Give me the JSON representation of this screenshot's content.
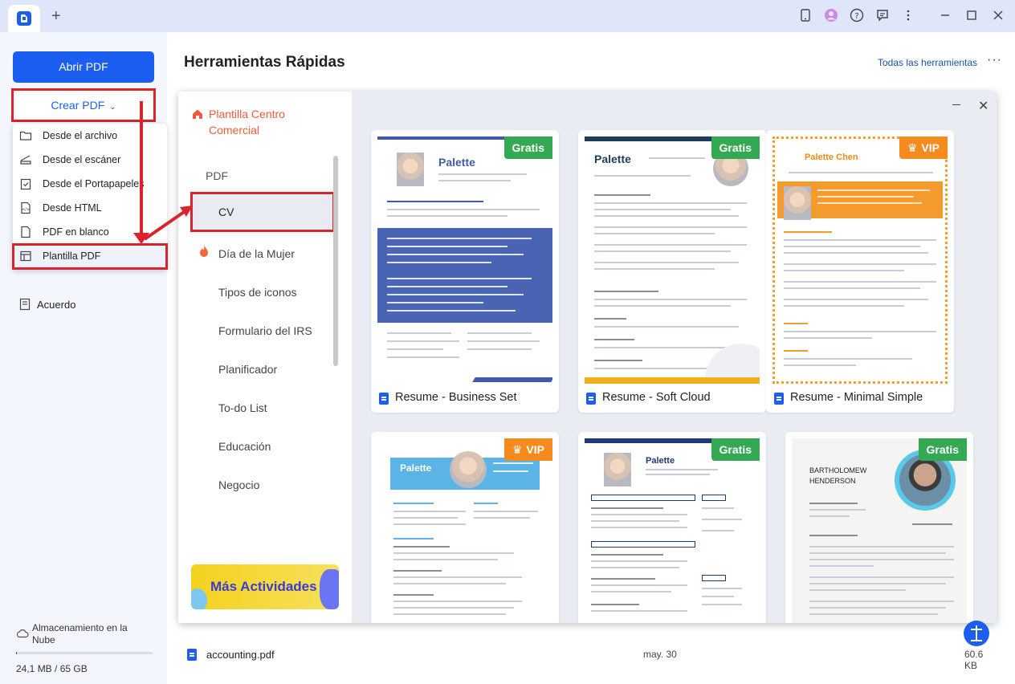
{
  "titlebar": {
    "new_tab_symbol": "+",
    "icons": [
      "tablet-icon",
      "avatar-icon",
      "help-icon",
      "feedback-icon",
      "more-vertical-icon",
      "minimize-icon",
      "maximize-icon",
      "close-icon"
    ]
  },
  "sidebar": {
    "open_button": "Abrir PDF",
    "create_button": "Crear PDF",
    "create_menu": [
      {
        "label": "Desde el archivo",
        "icon": "folder-icon"
      },
      {
        "label": "Desde el escáner",
        "icon": "scanner-icon"
      },
      {
        "label": "Desde el Portapapeles",
        "icon": "clipboard-icon"
      },
      {
        "label": "Desde HTML",
        "icon": "html-icon"
      },
      {
        "label": "PDF en blanco",
        "icon": "blank-page-icon"
      },
      {
        "label": "Plantilla PDF",
        "icon": "template-icon"
      }
    ],
    "agreement": "Acuerdo",
    "cloud_label": "Almacenamiento en la Nube",
    "storage": "24,1 MB / 65 GB",
    "storage_fraction": 0.0004
  },
  "main": {
    "title": "Herramientas Rápidas",
    "all_tools": "Todas las herramientas",
    "more": "···"
  },
  "templates_panel": {
    "header": "Plantilla Centro Comercial",
    "section": "PDF",
    "categories": [
      "CV",
      "Día de la Mujer",
      "Tipos de iconos",
      "Formulario del IRS",
      "Planificador",
      "To-do List",
      "Educación",
      "Negocio"
    ],
    "selected_category": "CV",
    "banner": "Más Actividades",
    "cards": [
      {
        "name": "Resume - Business Set",
        "badge": "Gratis",
        "thumb_title": "Palette"
      },
      {
        "name": "Resume - Soft Cloud",
        "badge": "Gratis",
        "thumb_title": "Palette"
      },
      {
        "name": "Resume - Minimal Simple",
        "badge": "VIP",
        "thumb_title": "Palette Chen"
      },
      {
        "name": "",
        "badge": "VIP",
        "thumb_title": "Palette"
      },
      {
        "name": "",
        "badge": "Gratis",
        "thumb_title": "Palette"
      },
      {
        "name": "",
        "badge": "Gratis",
        "thumb_title": "BARTHOLOMEW HENDERSON"
      }
    ]
  },
  "recent_file": {
    "name": "accounting.pdf",
    "date": "may. 30",
    "size": "60.6 KB"
  }
}
